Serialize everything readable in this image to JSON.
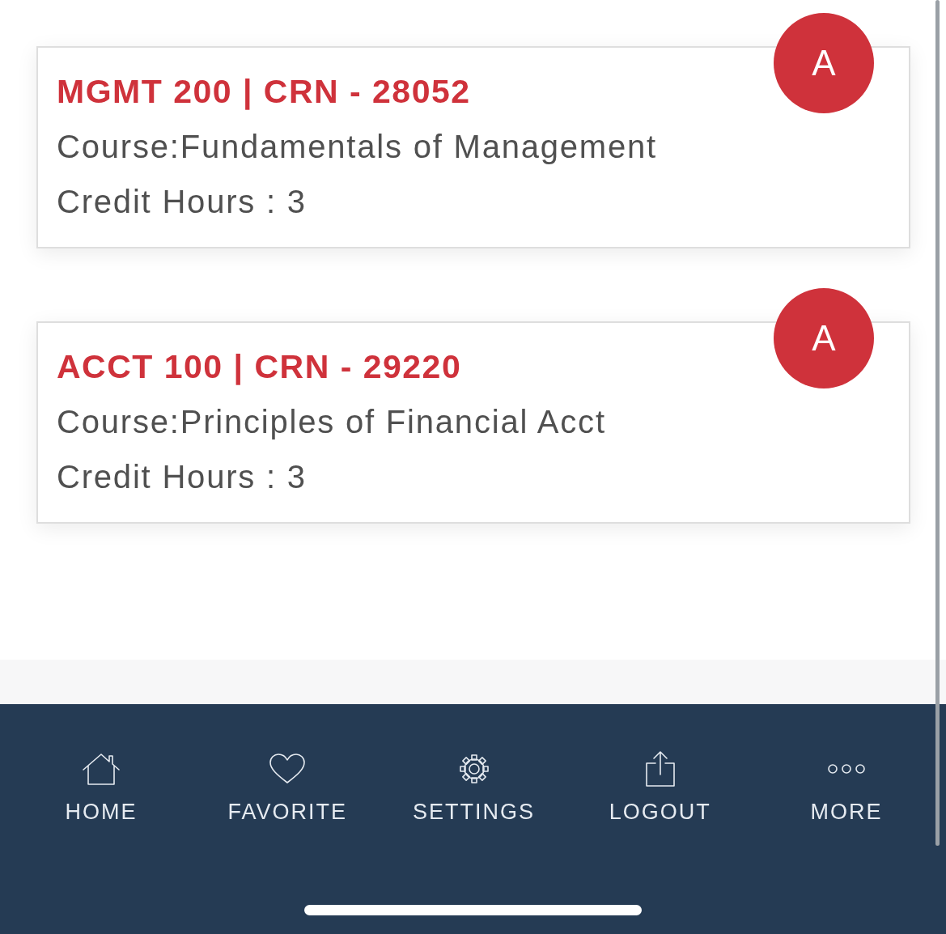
{
  "courses": [
    {
      "title": "MGMT 200 | CRN - 28052",
      "course": "Course:Fundamentals of Management",
      "credits": "Credit Hours : 3",
      "grade": "A"
    },
    {
      "title": "ACCT 100 | CRN - 29220",
      "course": "Course:Principles of Financial Acct",
      "credits": "Credit Hours : 3",
      "grade": "A"
    }
  ],
  "tab_bar": [
    {
      "label": "HOME"
    },
    {
      "label": "FAVORITE"
    },
    {
      "label": "SETTINGS"
    },
    {
      "label": "LOGOUT"
    },
    {
      "label": "MORE"
    }
  ]
}
